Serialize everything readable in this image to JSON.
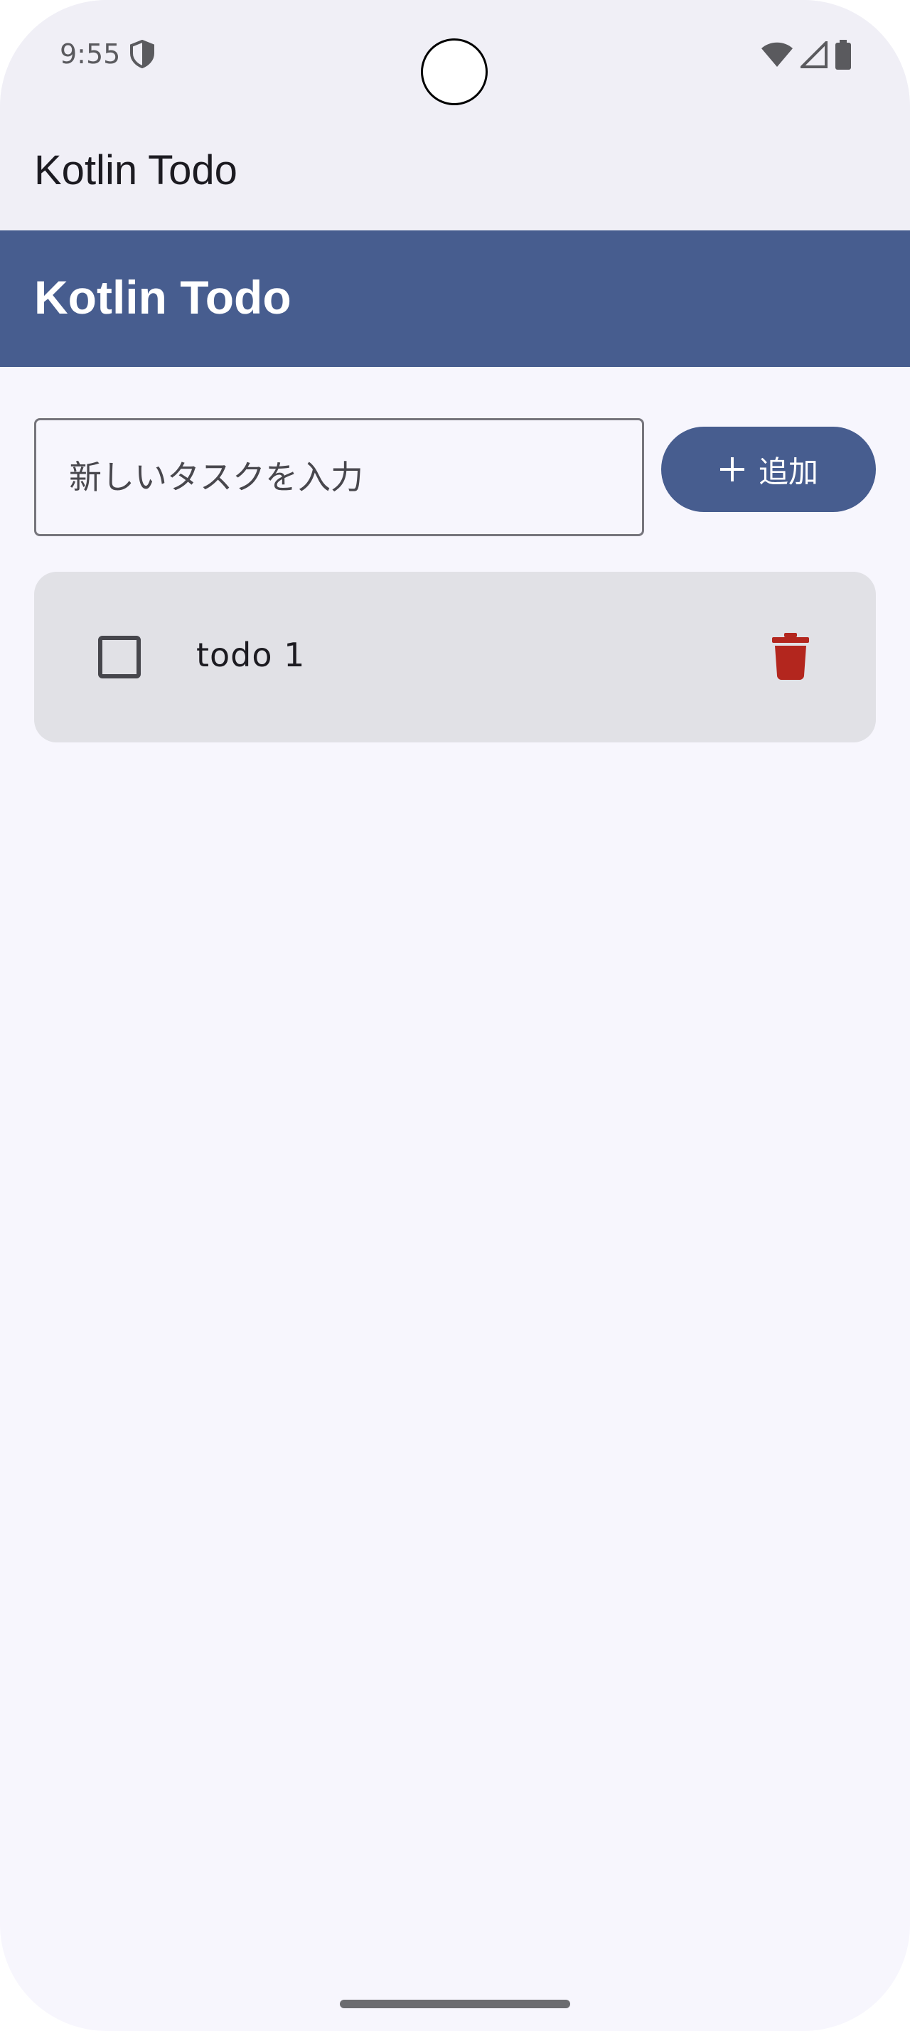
{
  "status_bar": {
    "time": "9:55",
    "icons": [
      "shield-icon",
      "wifi-icon",
      "signal-icon",
      "battery-icon"
    ]
  },
  "app_bar": {
    "title": "Kotlin Todo"
  },
  "header": {
    "title": "Kotlin Todo",
    "color": "#475d8f"
  },
  "input": {
    "placeholder": "新しいタスクを入力",
    "value": ""
  },
  "add_button": {
    "label": "追加",
    "icon": "plus-icon"
  },
  "todos": [
    {
      "text": "todo 1",
      "checked": false,
      "delete_icon": "trash-icon",
      "delete_color": "#b3261e"
    }
  ]
}
